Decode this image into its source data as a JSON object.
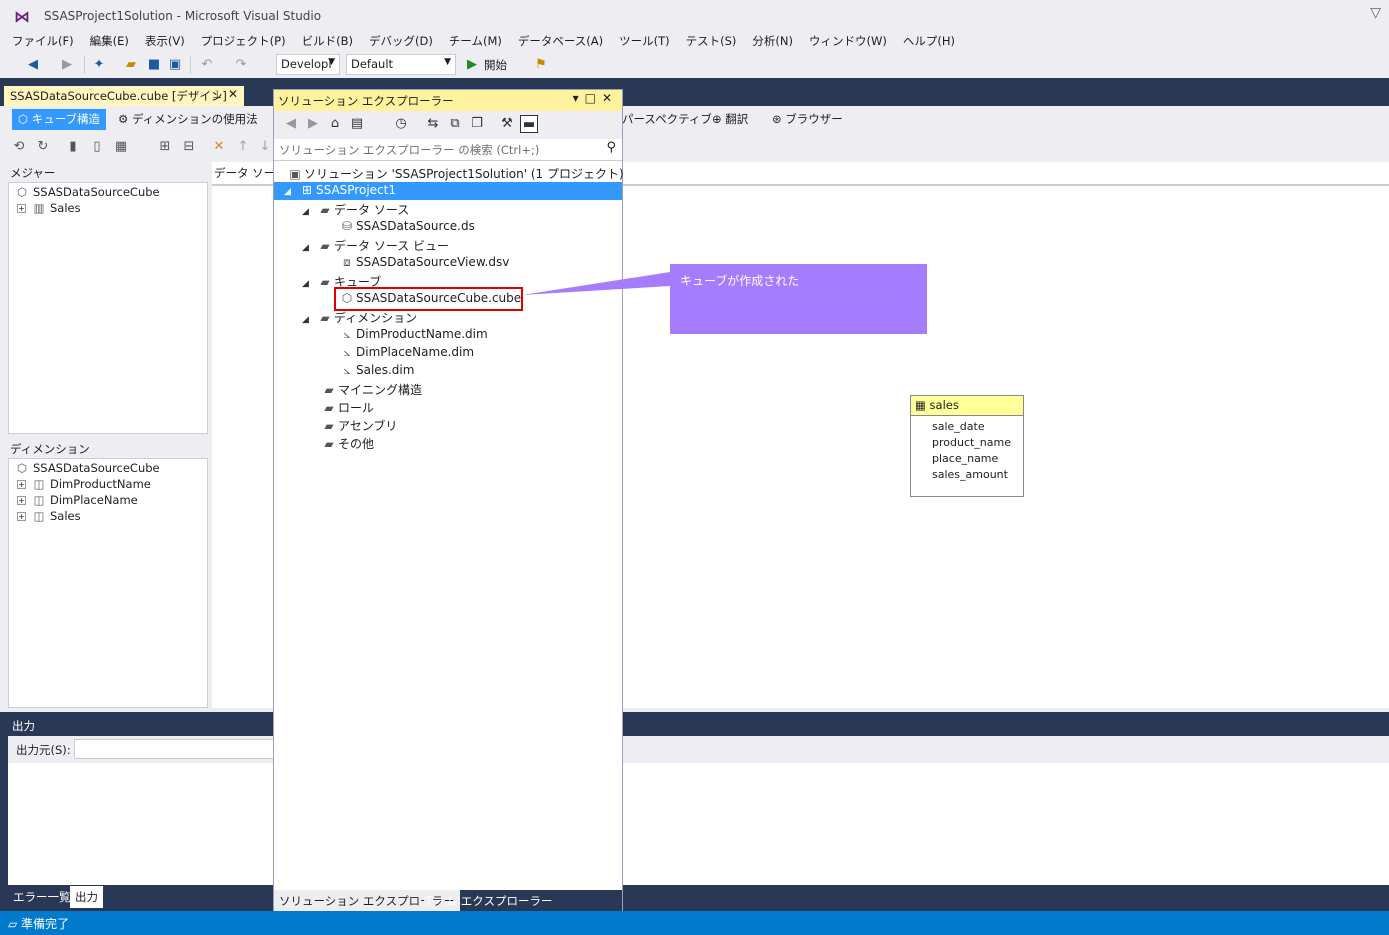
{
  "window": {
    "title": "SSASProject1Solution - Microsoft Visual Studio"
  },
  "menu": [
    "ファイル(F)",
    "編集(E)",
    "表示(V)",
    "プロジェクト(P)",
    "ビルド(B)",
    "デバッグ(D)",
    "チーム(M)",
    "データベース(A)",
    "ツール(T)",
    "テスト(S)",
    "分析(N)",
    "ウィンドウ(W)",
    "ヘルプ(H)"
  ],
  "toolbar": {
    "config": "Developi",
    "platform": "Default",
    "start": "開始"
  },
  "doc_tab": {
    "label": "SSASDataSourceCube.cube [デザイン]"
  },
  "designer_tabs": [
    "キューブ構造",
    "ディメンションの使用法",
    "パースペクティブ",
    "翻訳",
    "ブラウザー"
  ],
  "measures": {
    "header": "メジャー",
    "root": "SSASDataSourceCube",
    "items": [
      "Sales"
    ]
  },
  "dimensions": {
    "header": "ディメンション",
    "root": "SSASDataSourceCube",
    "items": [
      "DimProductName",
      "DimPlaceName",
      "Sales"
    ]
  },
  "dsv": {
    "header": "データ ソース",
    "table": {
      "name": "sales",
      "columns": [
        "sale_date",
        "product_name",
        "place_name",
        "sales_amount"
      ]
    }
  },
  "output": {
    "header": "出力",
    "source_label": "出力元(S):"
  },
  "bottom_tabs": [
    "エラー一覧",
    "出力"
  ],
  "status": "準備完了",
  "solution_explorer": {
    "title": "ソリューション エクスプローラー",
    "search_placeholder": "ソリューション エクスプローラー の検索 (Ctrl+;)",
    "solution": "ソリューション 'SSASProject1Solution' (1 プロジェクト)",
    "project": "SSASProject1",
    "folders": {
      "datasource": "データ ソース",
      "datasource_file": "SSASDataSource.ds",
      "dsv": "データ ソース ビュー",
      "dsv_file": "SSASDataSourceView.dsv",
      "cube": "キューブ",
      "cube_file": "SSASDataSourceCube.cube",
      "dimension": "ディメンション",
      "dim_files": [
        "DimProductName.dim",
        "DimPlaceName.dim",
        "Sales.dim"
      ],
      "mining": "マイニング構造",
      "role": "ロール",
      "assembly": "アセンブリ",
      "other": "その他"
    },
    "tabs": [
      "ソリューション エクスプローラー",
      "チーム エクスプローラー"
    ]
  },
  "callout": {
    "text": "キューブが作成された",
    "color": "#a67cff"
  }
}
